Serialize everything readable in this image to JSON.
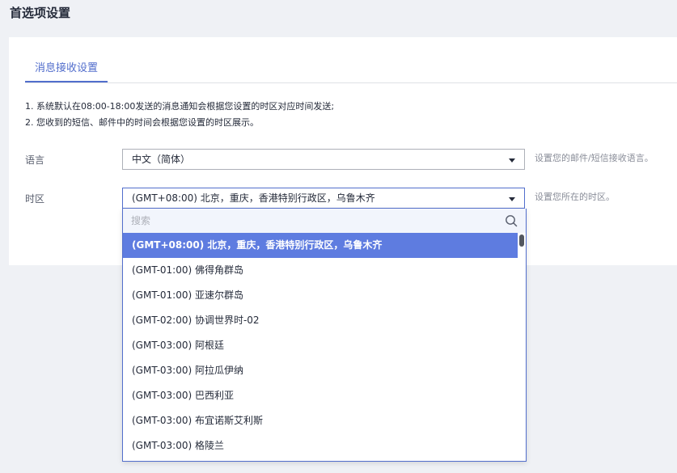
{
  "page": {
    "title": "首选项设置"
  },
  "tabs": [
    {
      "label": "消息接收设置",
      "active": true
    }
  ],
  "notes": [
    "1. 系统默认在08:00-18:00发送的消息通知会根据您设置的时区对应时间发送;",
    "2. 您收到的短信、邮件中的时间会根据您设置的时区展示。"
  ],
  "language": {
    "label": "语言",
    "value": "中文（简体）",
    "hint": "设置您的邮件/短信接收语言。"
  },
  "timezone": {
    "label": "时区",
    "value": "(GMT+08:00) 北京，重庆，香港特别行政区，乌鲁木齐",
    "hint": "设置您所在的时区。"
  },
  "dropdown": {
    "search_placeholder": "搜索",
    "options": [
      "(GMT+08:00) 北京，重庆，香港特别行政区，乌鲁木齐",
      "(GMT-01:00) 佛得角群岛",
      "(GMT-01:00) 亚速尔群岛",
      "(GMT-02:00) 协调世界时-02",
      "(GMT-03:00) 阿根廷",
      "(GMT-03:00) 阿拉瓜伊纳",
      "(GMT-03:00) 巴西利亚",
      "(GMT-03:00) 布宜诺斯艾利斯",
      "(GMT-03:00) 格陵兰"
    ],
    "selected_index": 0
  },
  "colors": {
    "accent": "#526ecc",
    "selected_bg": "#5e7ce0",
    "page_bg": "#eff1f5"
  }
}
